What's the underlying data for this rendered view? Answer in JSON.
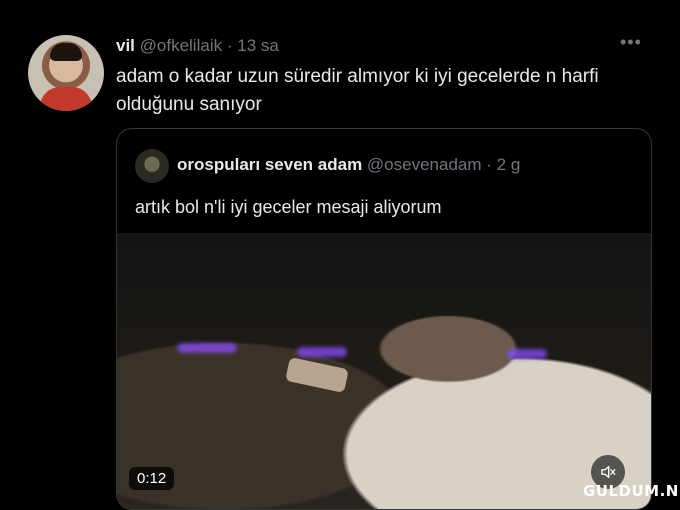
{
  "tweet": {
    "display_name": "vil",
    "handle": "@ofkelilaik",
    "separator": "·",
    "time": "13 sa",
    "more_icon": "more-icon",
    "text": "adam o kadar uzun süredir almıyor ki iyi gecelerde n harfi olduğunu sanıyor"
  },
  "quote": {
    "display_name": "orospuları seven adam",
    "handle": "@osevenadam",
    "separator": "·",
    "time": "2 g",
    "text": "artık bol n'li iyi geceler mesaji aliyorum",
    "video": {
      "duration": "0:12",
      "volume_icon": "volume-icon"
    }
  },
  "watermark": "GULDUM.NET"
}
